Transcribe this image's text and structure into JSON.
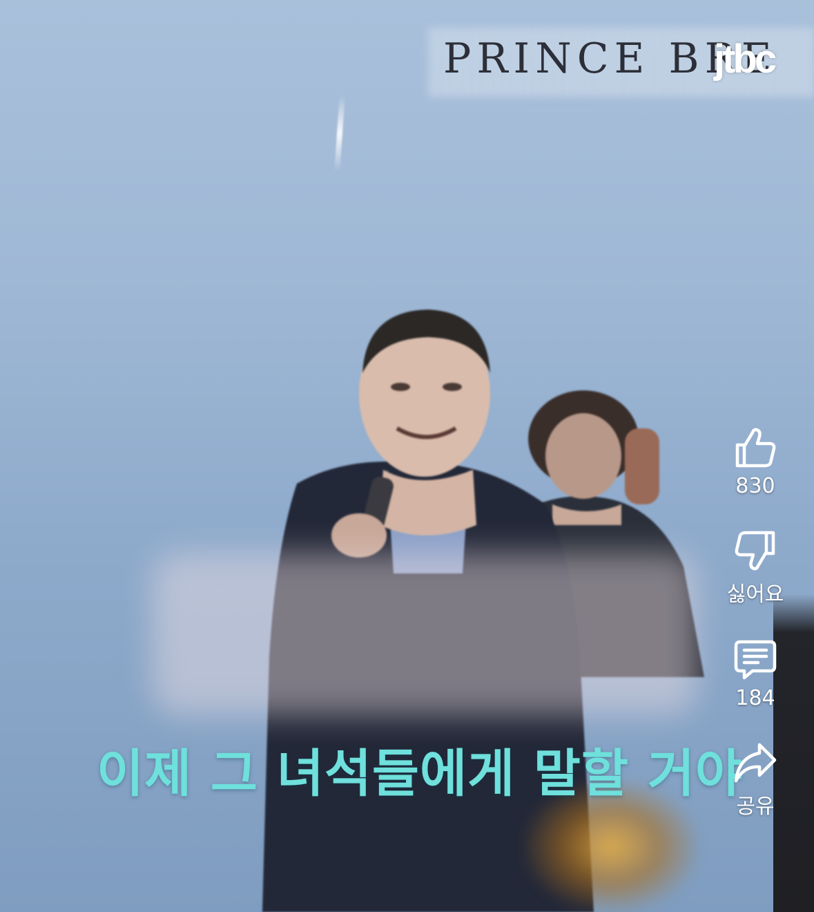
{
  "video": {
    "backdrop_sign": "PRINCE BRE",
    "channel_logo": "jtbc",
    "subtitle": "이제 그 녀석들에게 말할 거야"
  },
  "actions": {
    "like": {
      "icon": "thumbs-up-icon",
      "label": "830"
    },
    "dislike": {
      "icon": "thumbs-down-icon",
      "label": "싫어요"
    },
    "comments": {
      "icon": "comment-icon",
      "label": "184"
    },
    "share": {
      "icon": "share-icon",
      "label": "공유"
    }
  },
  "colors": {
    "subtitle": "#6fe0dc",
    "icon": "#ffffff"
  }
}
